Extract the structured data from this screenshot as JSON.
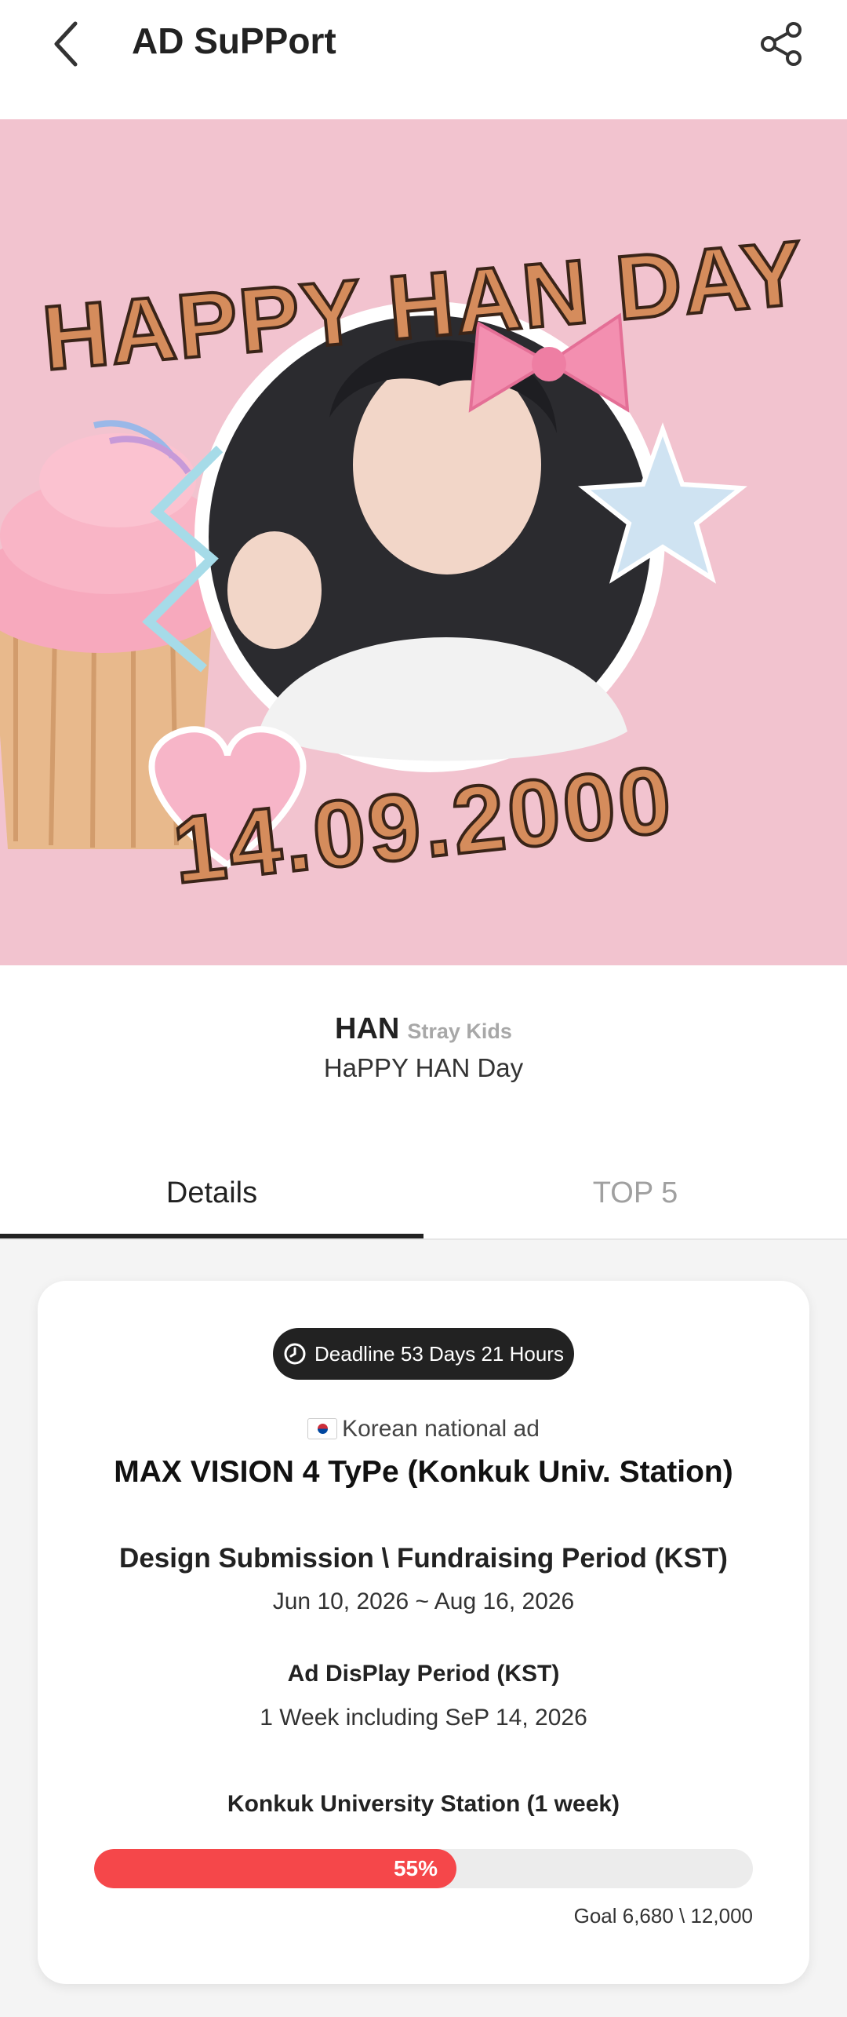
{
  "header": {
    "title": "AD SuPPort"
  },
  "hero": {
    "headline": "HAPPY HAN DAY",
    "date": "14.09.2000"
  },
  "artist": {
    "name": "HAN",
    "group": "Stray Kids",
    "event": "HaPPY HAN Day"
  },
  "tabs": [
    {
      "label": "Details",
      "active": true
    },
    {
      "label": "TOP 5",
      "active": false
    }
  ],
  "card": {
    "deadline": "Deadline 53 Days 21 Hours",
    "ad_category": "Korean national ad",
    "ad_name": "MAX VISION 4 TyPe (Konkuk Univ. Station)",
    "period_label": "Design Submission \\ Fundraising Period (KST)",
    "period_value": "Jun 10, 2026 ~ Aug 16, 2026",
    "display_label": "Ad DisPlay Period (KST)",
    "display_value": "1 Week including SeP 14, 2026",
    "location_label": "Konkuk University Station (1 week)",
    "progress_percent": 55,
    "progress_label": "55%",
    "goal": "Goal 6,680 \\ 12,000"
  },
  "colors": {
    "accent": "#f5474a",
    "hero_bg": "#f2c3cf",
    "dark": "#222222"
  }
}
